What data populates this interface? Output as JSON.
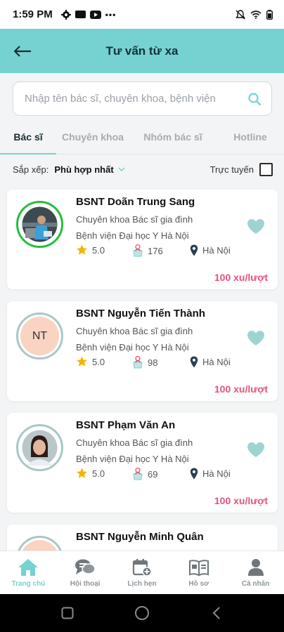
{
  "status_bar": {
    "time": "1:59 PM"
  },
  "header": {
    "title": "Tư vấn từ xa"
  },
  "search": {
    "placeholder": "Nhập tên bác sĩ, chuyên khoa, bệnh viện"
  },
  "tabs": [
    {
      "label": "Bác sĩ",
      "active": true
    },
    {
      "label": "Chuyên khoa",
      "active": false
    },
    {
      "label": "Nhóm bác sĩ",
      "active": false
    },
    {
      "label": "Hotline",
      "active": false
    }
  ],
  "sort": {
    "label": "Sắp xếp:",
    "value": "Phù hợp nhất",
    "online_label": "Trực tuyến",
    "online_checked": false
  },
  "doctors": [
    {
      "name": "BSNT Doãn Trung Sang",
      "specialty": "Chuyên khoa Bác sĩ gia đình",
      "hospital": "Bệnh viện Đại học Y Hà Nội",
      "rating": "5.0",
      "consults": "176",
      "location": "Hà Nội",
      "price": "100 xu/lượt",
      "avatar": "photo",
      "online": true
    },
    {
      "name": "BSNT Nguyễn Tiến Thành",
      "specialty": "Chuyên khoa Bác sĩ gia đình",
      "hospital": "Bệnh viện Đại học Y Hà Nội",
      "rating": "5.0",
      "consults": "98",
      "location": "Hà Nội",
      "price": "100 xu/lượt",
      "avatar": "initials",
      "initials": "NT",
      "online": false
    },
    {
      "name": "BSNT Phạm Văn An",
      "specialty": "Chuyên khoa Bác sĩ gia đình",
      "hospital": "Bệnh viện Đại học Y Hà Nội",
      "rating": "5.0",
      "consults": "69",
      "location": "Hà Nội",
      "price": "100 xu/lượt",
      "avatar": "photo",
      "online": false
    },
    {
      "name": "BSNT Nguyễn Minh Quân",
      "avatar": "initials",
      "online": false
    }
  ],
  "bottom_nav": [
    {
      "label": "Trang chủ",
      "icon": "home-icon",
      "active": true
    },
    {
      "label": "Hội thoại",
      "icon": "chat-icon",
      "active": false
    },
    {
      "label": "Lịch hẹn",
      "icon": "calendar-add-icon",
      "active": false
    },
    {
      "label": "Hồ sơ",
      "icon": "book-icon",
      "active": false
    },
    {
      "label": "Cá nhân",
      "icon": "person-icon",
      "active": false
    }
  ],
  "colors": {
    "accent": "#76d2d0",
    "price": "#e8527a",
    "online_ring": "#22c03a",
    "offline_ring": "#a9c7c6",
    "heart": "#9fd3d1",
    "star": "#f6b400",
    "location_pin": "#2d3e50"
  }
}
